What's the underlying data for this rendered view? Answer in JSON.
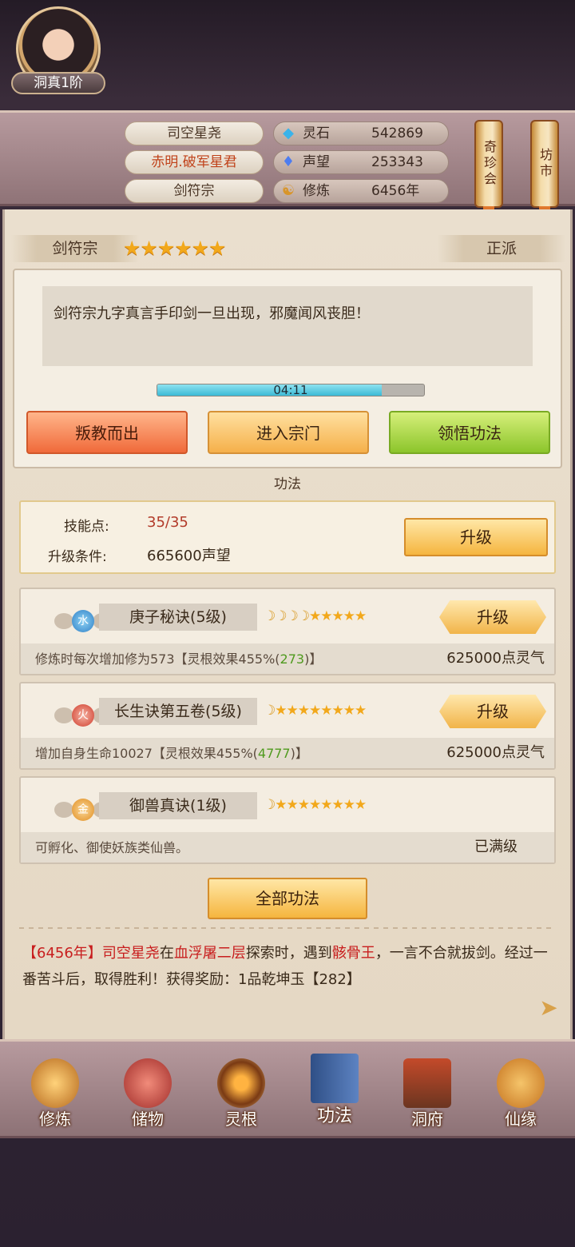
{
  "player": {
    "name": "司空星尧",
    "title": "赤明.破军星君",
    "sect": "剑符宗",
    "rank": "洞真1阶"
  },
  "resources": [
    {
      "icon": "spirit-stone-icon",
      "label": "灵石",
      "value": "542869"
    },
    {
      "icon": "reputation-icon",
      "label": "声望",
      "value": "253343"
    },
    {
      "icon": "cultivation-icon",
      "label": "修炼",
      "value": "6456年"
    }
  ],
  "top_buttons": {
    "treasure": "奇珍会",
    "market": "坊市"
  },
  "sect_panel": {
    "name": "剑符宗",
    "stars": "★★★★★★",
    "alignment": "正派",
    "description": "剑符宗九字真言手印剑一旦出现，邪魔闻风丧胆！",
    "timer": "04:11",
    "progress": 0.84,
    "actions": {
      "leave": "叛教而出",
      "enter": "进入宗门",
      "learn": "领悟功法"
    }
  },
  "gongfa": {
    "section_title": "功法",
    "skill_points_label": "技能点:",
    "skill_points_value": "35/35",
    "upgrade_cond_label": "升级条件:",
    "upgrade_cond_value": "665600声望",
    "upgrade_button": "升级",
    "skills": [
      {
        "element": "水",
        "name": "庚子秘诀(5级)",
        "moons": "☽☽☽☽",
        "stars": "★★★★★",
        "desc_pre": "修炼时每次增加修为573【灵根效果455%(",
        "desc_green": "273",
        "desc_post": ")】",
        "cost": "625000点灵气",
        "button": "升级"
      },
      {
        "element": "火",
        "name": "长生诀第五卷(5级)",
        "moons": "☽",
        "stars": "★★★★★★★★",
        "desc_pre": "增加自身生命10027【灵根效果455%(",
        "desc_green": "4777",
        "desc_post": ")】",
        "cost": "625000点灵气",
        "button": "升级"
      },
      {
        "element": "金",
        "name": "御兽真诀(1级)",
        "moons": "☽",
        "stars": "★★★★★★★★",
        "desc": "可孵化、御使妖族类仙兽。",
        "status": "已满级"
      }
    ],
    "all_button": "全部功法"
  },
  "log": {
    "year": "【6456年】",
    "player": "司空星尧",
    "t1": "在",
    "place": "血浮屠二层",
    "t2": "探索时，遇到",
    "enemy": "骸骨王",
    "t3": "，一言不合就拔剑。经过一番苦斗后，取得胜利！获得奖励：1品乾坤玉【282】"
  },
  "nav": [
    "修炼",
    "储物",
    "灵根",
    "功法",
    "洞府",
    "仙缘"
  ],
  "colors": {
    "accent_red": "#c81e1e",
    "accent_green": "#4f9a1e",
    "gold": "#f2a81b"
  }
}
